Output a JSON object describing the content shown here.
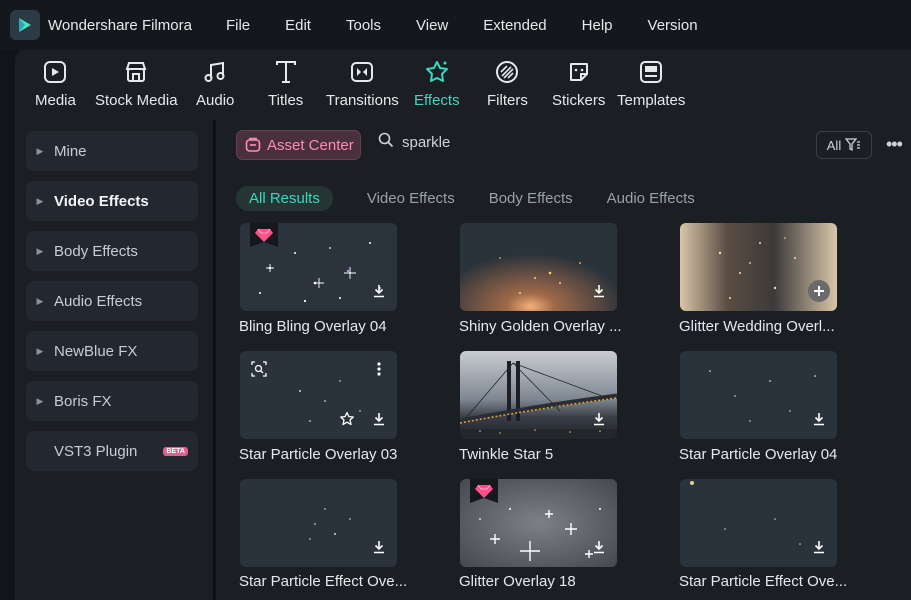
{
  "app": {
    "name": "Wondershare Filmora"
  },
  "menu": [
    "File",
    "Edit",
    "Tools",
    "View",
    "Extended",
    "Help",
    "Version"
  ],
  "toolbar": [
    {
      "label": "Media",
      "icon": "media-icon"
    },
    {
      "label": "Stock Media",
      "icon": "stock-media-icon"
    },
    {
      "label": "Audio",
      "icon": "audio-icon"
    },
    {
      "label": "Titles",
      "icon": "titles-icon"
    },
    {
      "label": "Transitions",
      "icon": "transitions-icon"
    },
    {
      "label": "Effects",
      "icon": "effects-icon",
      "active": true
    },
    {
      "label": "Filters",
      "icon": "filters-icon"
    },
    {
      "label": "Stickers",
      "icon": "stickers-icon"
    },
    {
      "label": "Templates",
      "icon": "templates-icon"
    }
  ],
  "sidebar": {
    "items": [
      {
        "label": "Mine"
      },
      {
        "label": "Video Effects",
        "selected": true
      },
      {
        "label": "Body Effects"
      },
      {
        "label": "Audio Effects"
      },
      {
        "label": "NewBlue FX"
      },
      {
        "label": "Boris FX"
      },
      {
        "label": "VST3 Plugin",
        "badge": "BETA"
      }
    ]
  },
  "main": {
    "asset_center_label": "Asset Center",
    "search_value": "sparkle",
    "filter_label": "All",
    "tabs": [
      {
        "label": "All Results",
        "active": true
      },
      {
        "label": "Video Effects"
      },
      {
        "label": "Body Effects"
      },
      {
        "label": "Audio Effects"
      }
    ],
    "cards": [
      {
        "title": "Bling Bling Overlay 04",
        "premium": true,
        "action": "download"
      },
      {
        "title": "Shiny Golden Overlay ...",
        "action": "download"
      },
      {
        "title": "Glitter Wedding Overl...",
        "action": "add"
      },
      {
        "title": "Star Particle Overlay 03",
        "action": "download",
        "favorite": true,
        "hovered": true
      },
      {
        "title": "Twinkle Star 5",
        "action": "download"
      },
      {
        "title": "Star Particle Overlay 04",
        "action": "download"
      },
      {
        "title": "Star Particle Effect Ove...",
        "action": "download"
      },
      {
        "title": "Glitter Overlay 18",
        "premium": true,
        "action": "download"
      },
      {
        "title": "Star Particle Effect Ove...",
        "action": "download"
      }
    ]
  },
  "colors": {
    "accent": "#38d9c0",
    "asset_center": "#ff8db5",
    "premium": "#ff4f8b"
  }
}
